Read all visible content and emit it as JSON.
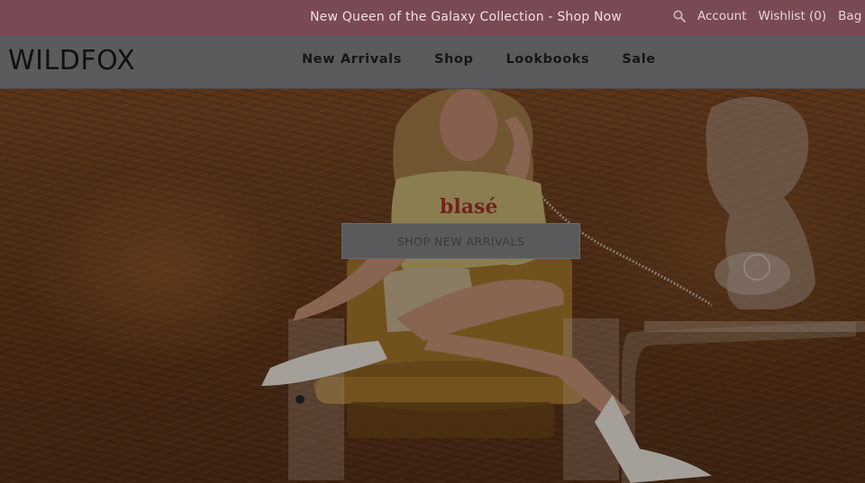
{
  "promo": {
    "text": "New Queen of the Galaxy Collection - Shop Now"
  },
  "util_nav": {
    "account": "Account",
    "wishlist": "Wishlist (0)",
    "bag": "Bag"
  },
  "header": {
    "logo": "WILDFOX"
  },
  "main_nav": {
    "items": [
      "New Arrivals",
      "Shop",
      "Lookbooks",
      "Sale"
    ]
  },
  "hero": {
    "shirt_text": "blasé",
    "cta_label": "SHOP NEW ARRIVALS"
  },
  "colors": {
    "promo_bg": "#7a4a54",
    "header_bg": "#5b5b5d",
    "hero_bg": "#5a3419"
  },
  "icons": {
    "search": "search-icon"
  }
}
